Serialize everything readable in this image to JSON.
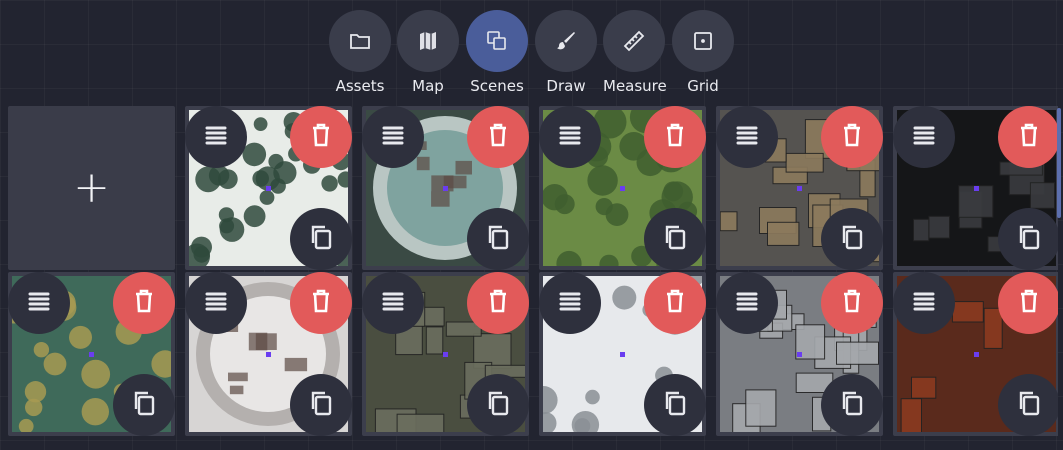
{
  "toolbar": {
    "tools": [
      {
        "label": "Assets",
        "icon": "folder-icon",
        "active": false
      },
      {
        "label": "Map",
        "icon": "map-icon",
        "active": false
      },
      {
        "label": "Scenes",
        "icon": "scenes-icon",
        "active": true
      },
      {
        "label": "Draw",
        "icon": "brush-icon",
        "active": false
      },
      {
        "label": "Measure",
        "icon": "ruler-icon",
        "active": false
      },
      {
        "label": "Grid",
        "icon": "grid-icon",
        "active": false
      }
    ]
  },
  "colors": {
    "background": "#222430",
    "tool_button": "#3a3d4b",
    "tool_active": "#4a5d9a",
    "delete": "#e25a5a",
    "tile": "#3c3e4c"
  },
  "scenes": {
    "add_label": "+",
    "items": [
      {
        "theme": "snow-forest"
      },
      {
        "theme": "circular-lab"
      },
      {
        "theme": "forest"
      },
      {
        "theme": "space-station"
      },
      {
        "theme": "hangar"
      },
      {
        "theme": "swamp"
      },
      {
        "theme": "snow-castle"
      },
      {
        "theme": "stone-floor"
      },
      {
        "theme": "snow-mountain"
      },
      {
        "theme": "prison-blocks"
      },
      {
        "theme": "throne-hall"
      }
    ]
  }
}
